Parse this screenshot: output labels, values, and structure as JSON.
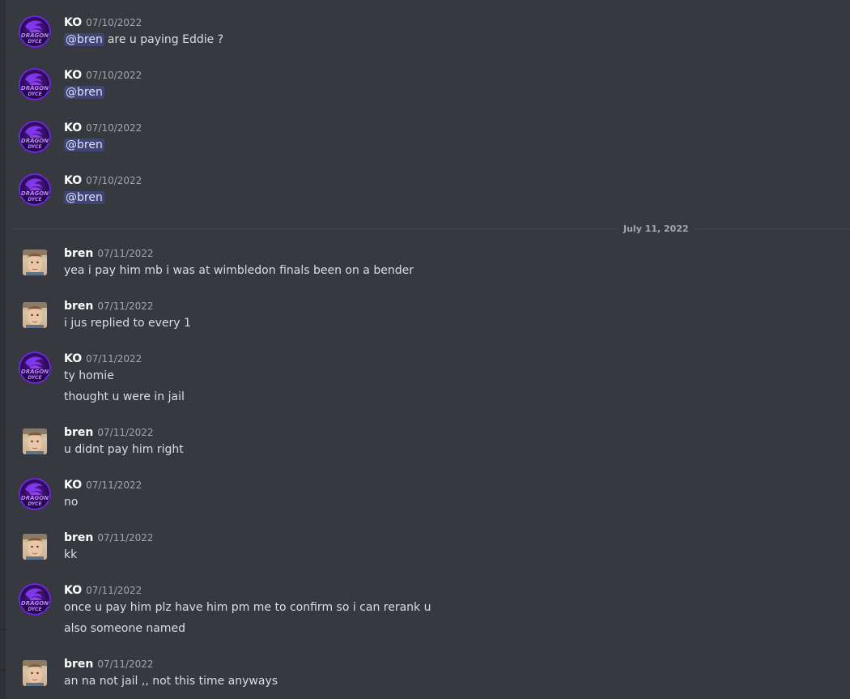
{
  "users": {
    "ko": {
      "name": "KO",
      "avatar_text": [
        "DRAGON",
        "DYCE"
      ]
    },
    "bren": {
      "name": "bren"
    }
  },
  "date_divider": "July 11, 2022",
  "messages": [
    {
      "user": "KO",
      "time": "07/10/2022",
      "mention": "@bren",
      "lines": [
        "are u paying Eddie ?"
      ]
    },
    {
      "user": "KO",
      "time": "07/10/2022",
      "mention": "@bren",
      "lines": [
        ""
      ]
    },
    {
      "user": "KO",
      "time": "07/10/2022",
      "mention": "@bren",
      "lines": [
        ""
      ]
    },
    {
      "user": "KO",
      "time": "07/10/2022",
      "mention": "@bren",
      "lines": [
        ""
      ]
    },
    {
      "user": "bren",
      "time": "07/11/2022",
      "lines": [
        "yea i pay him mb i was at wimbledon finals been on a bender"
      ]
    },
    {
      "user": "bren",
      "time": "07/11/2022",
      "lines": [
        "i jus replied to every 1"
      ]
    },
    {
      "user": "KO",
      "time": "07/11/2022",
      "lines": [
        "ty homie",
        "thought u were in jail"
      ]
    },
    {
      "user": "bren",
      "time": "07/11/2022",
      "lines": [
        "u didnt pay him right"
      ]
    },
    {
      "user": "KO",
      "time": "07/11/2022",
      "lines": [
        "no"
      ]
    },
    {
      "user": "bren",
      "time": "07/11/2022",
      "lines": [
        "kk"
      ]
    },
    {
      "user": "KO",
      "time": "07/11/2022",
      "lines": [
        "once u pay him plz  have him pm me to confirm so i can rerank u",
        "also   someone named"
      ]
    },
    {
      "user": "bren",
      "time": "07/11/2022",
      "lines": [
        "an na not jail ,, not this time anyways"
      ]
    }
  ]
}
